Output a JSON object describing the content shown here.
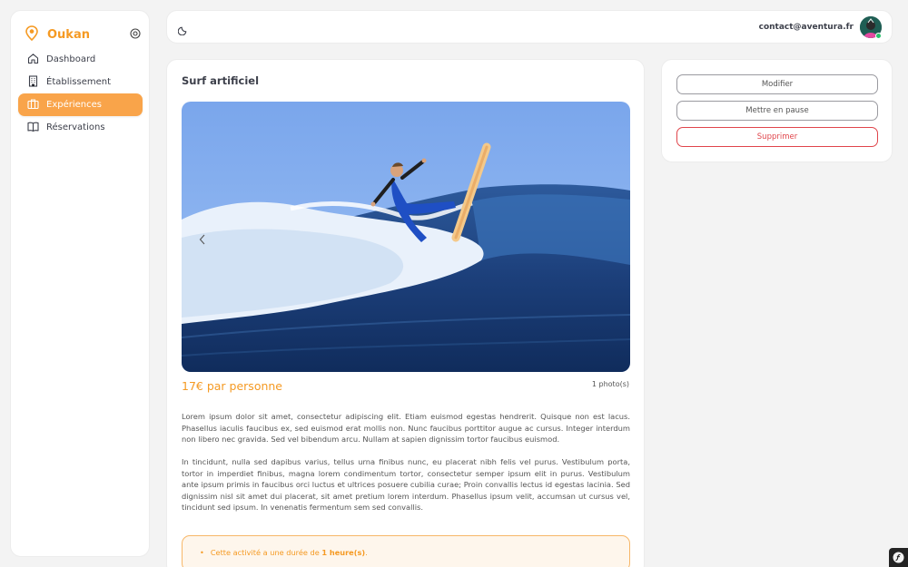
{
  "brand": {
    "name": "Oukan",
    "accent": "#f59a23"
  },
  "sidebar": {
    "items": [
      {
        "label": "Dashboard",
        "icon": "home-icon",
        "active": false
      },
      {
        "label": "Établissement",
        "icon": "building-icon",
        "active": false
      },
      {
        "label": "Expériences",
        "icon": "briefcase-icon",
        "active": true
      },
      {
        "label": "Réservations",
        "icon": "book-icon",
        "active": false
      }
    ]
  },
  "header": {
    "email": "contact@aventura.fr"
  },
  "experience": {
    "title": "Surf artificiel",
    "price": "17€ par personne",
    "photo_count": "1 photo(s)",
    "description_1": "Lorem ipsum dolor sit amet, consectetur adipiscing elit. Etiam euismod egestas hendrerit. Quisque non est lacus. Phasellus iaculis faucibus ex, sed euismod erat mollis non. Nunc faucibus porttitor augue ac cursus. Integer interdum non libero nec gravida. Sed vel bibendum arcu. Nullam at sapien dignissim tortor faucibus euismod.",
    "description_2": "In tincidunt, nulla sed dapibus varius, tellus urna finibus nunc, eu placerat nibh felis vel purus. Vestibulum porta, tortor in imperdiet finibus, magna lorem condimentum tortor, consectetur semper ipsum elit in purus. Vestibulum ante ipsum primis in faucibus orci luctus et ultrices posuere cubilia curae; Proin convallis lectus id egestas lacinia. Sed dignissim nisl sit amet dui placerat, sit amet pretium lorem interdum. Phasellus ipsum velit, accumsan ut cursus vel, tincidunt sed ipsum. In venenatis fermentum sem sed convallis.",
    "notice_prefix": "Cette activité a une durée de ",
    "notice_duration": "1 heure(s)",
    "notice_suffix": "."
  },
  "actions": {
    "edit_label": "Modifier",
    "pause_label": "Mettre en pause",
    "delete_label": "Supprimer"
  },
  "colors": {
    "danger": "#e0454b",
    "active_nav": "#f9a44a"
  }
}
